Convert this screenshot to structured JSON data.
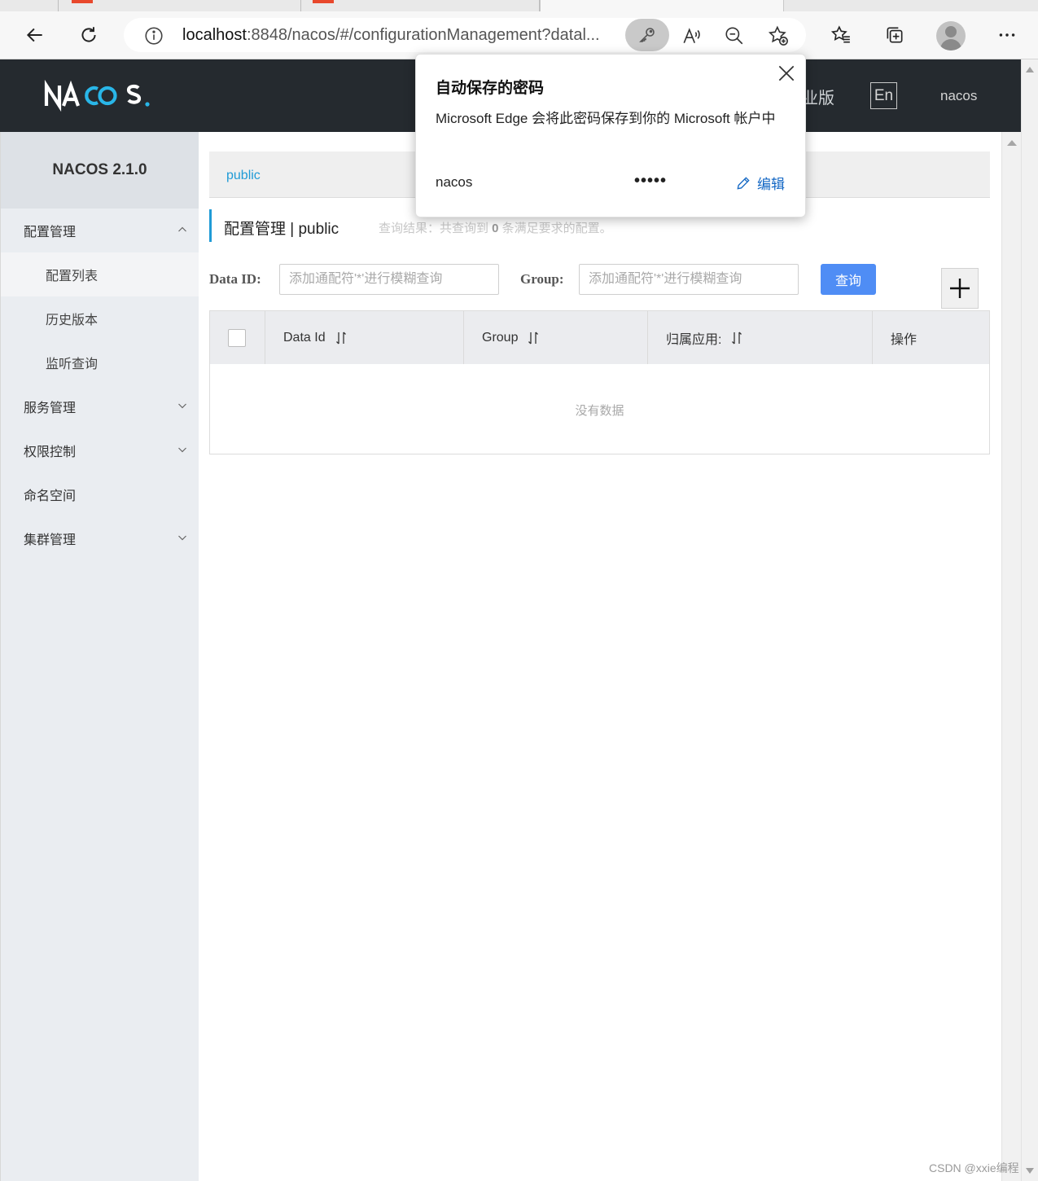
{
  "browser": {
    "url_host": "localhost",
    "url_rest": ":8848/nacos/#/configurationManagement?datal...",
    "icons": [
      "back-arrow-icon",
      "refresh-icon",
      "info-icon",
      "key-icon",
      "read-aloud-icon",
      "zoom-out-icon",
      "favorite-add-icon",
      "favorites-icon",
      "collections-icon",
      "profile-icon",
      "more-icon"
    ]
  },
  "header": {
    "partial_label": "业版",
    "lang_button": "En",
    "user": "nacos"
  },
  "sidebar": {
    "version": "NACOS 2.1.0",
    "items": [
      {
        "label": "配置管理"
      },
      {
        "label": "配置列表"
      },
      {
        "label": "历史版本"
      },
      {
        "label": "监听查询"
      },
      {
        "label": "服务管理"
      },
      {
        "label": "权限控制"
      },
      {
        "label": "命名空间"
      },
      {
        "label": "集群管理"
      }
    ]
  },
  "main": {
    "namespace": "public",
    "title": "配置管理  |  public",
    "result_prefix": "查询结果：共查询到 ",
    "result_count": "0",
    "result_suffix": " 条满足要求的配置。",
    "filter": {
      "dataid_label": "Data ID:",
      "dataid_placeholder": "添加通配符'*'进行模糊查询",
      "group_label": "Group:",
      "group_placeholder": "添加通配符'*'进行模糊查询",
      "query_button": "查询",
      "add_button": "+"
    },
    "table": {
      "columns": [
        "Data Id",
        "Group",
        "归属应用:",
        "操作"
      ],
      "empty_text": "没有数据"
    }
  },
  "popup": {
    "title": "自动保存的密码",
    "description": "Microsoft Edge 会将此密码保存到你的 Microsoft 帐户中",
    "username": "nacos",
    "password_mask": "•••••",
    "edit_label": "编辑"
  },
  "watermark": "CSDN @xxie编程",
  "colors": {
    "header_bg": "#252a2f",
    "accent": "#209bd6",
    "query_button": "#4f8df5",
    "edge_link": "#1367c4"
  }
}
